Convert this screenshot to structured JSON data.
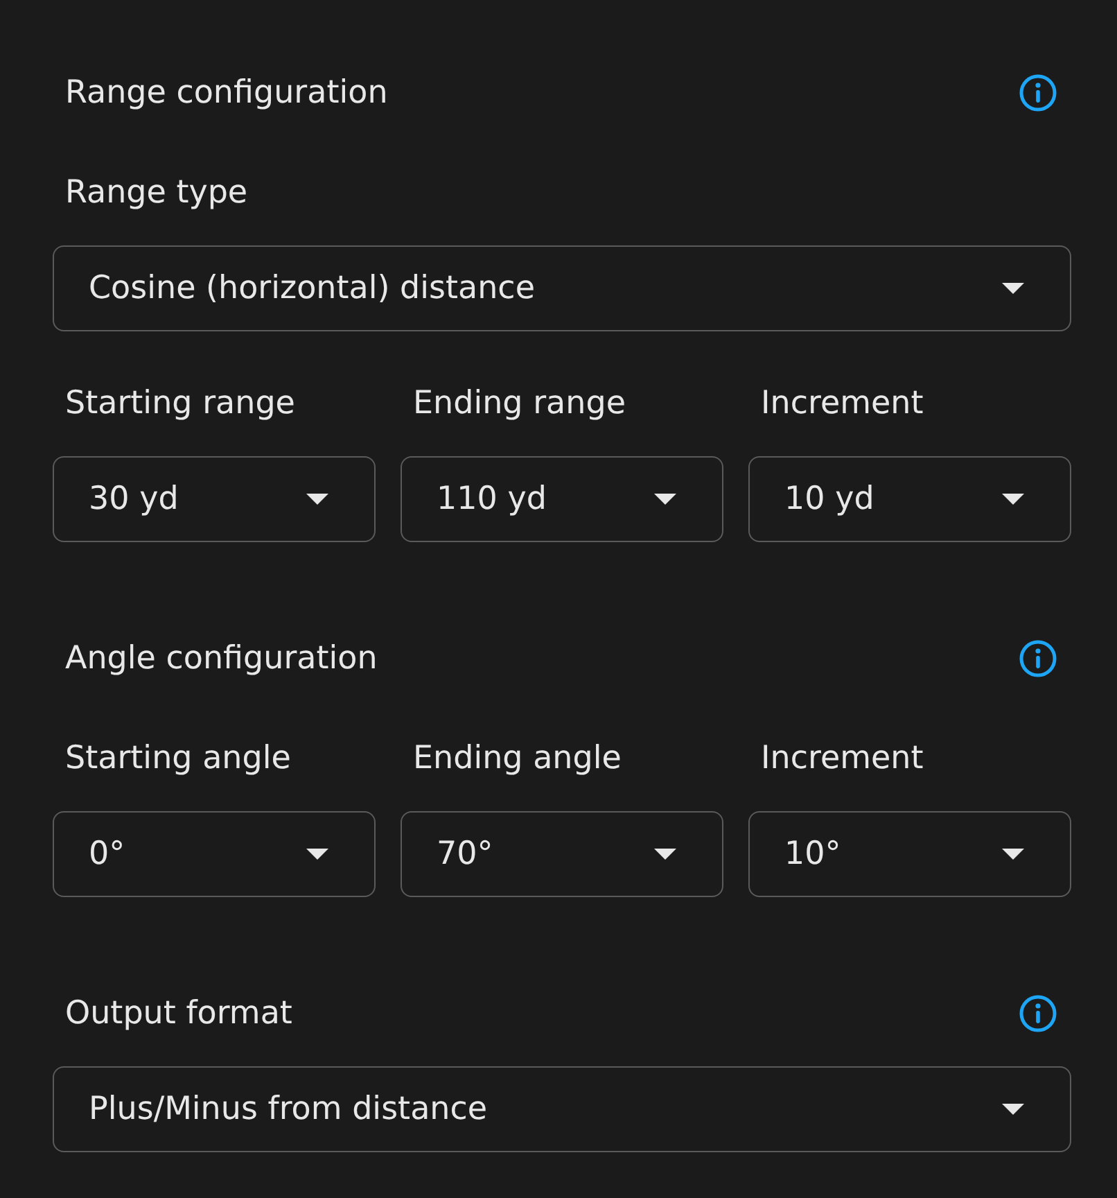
{
  "sections": [
    {
      "title": "Range configuration",
      "rows": [
        [
          {
            "label": "Range type",
            "value": "Cosine (horizontal) distance"
          }
        ],
        [
          {
            "label": "Starting range",
            "value": "30 yd"
          },
          {
            "label": "Ending range",
            "value": "110 yd"
          },
          {
            "label": "Increment",
            "value": "10 yd"
          }
        ]
      ]
    },
    {
      "title": "Angle configuration",
      "rows": [
        [
          {
            "label": "Starting angle",
            "value": "0°"
          },
          {
            "label": "Ending angle",
            "value": "70°"
          },
          {
            "label": "Increment",
            "value": "10°"
          }
        ]
      ]
    },
    {
      "title": "Output format",
      "rows": [
        [
          {
            "value": "Plus/Minus from distance"
          }
        ]
      ]
    }
  ]
}
